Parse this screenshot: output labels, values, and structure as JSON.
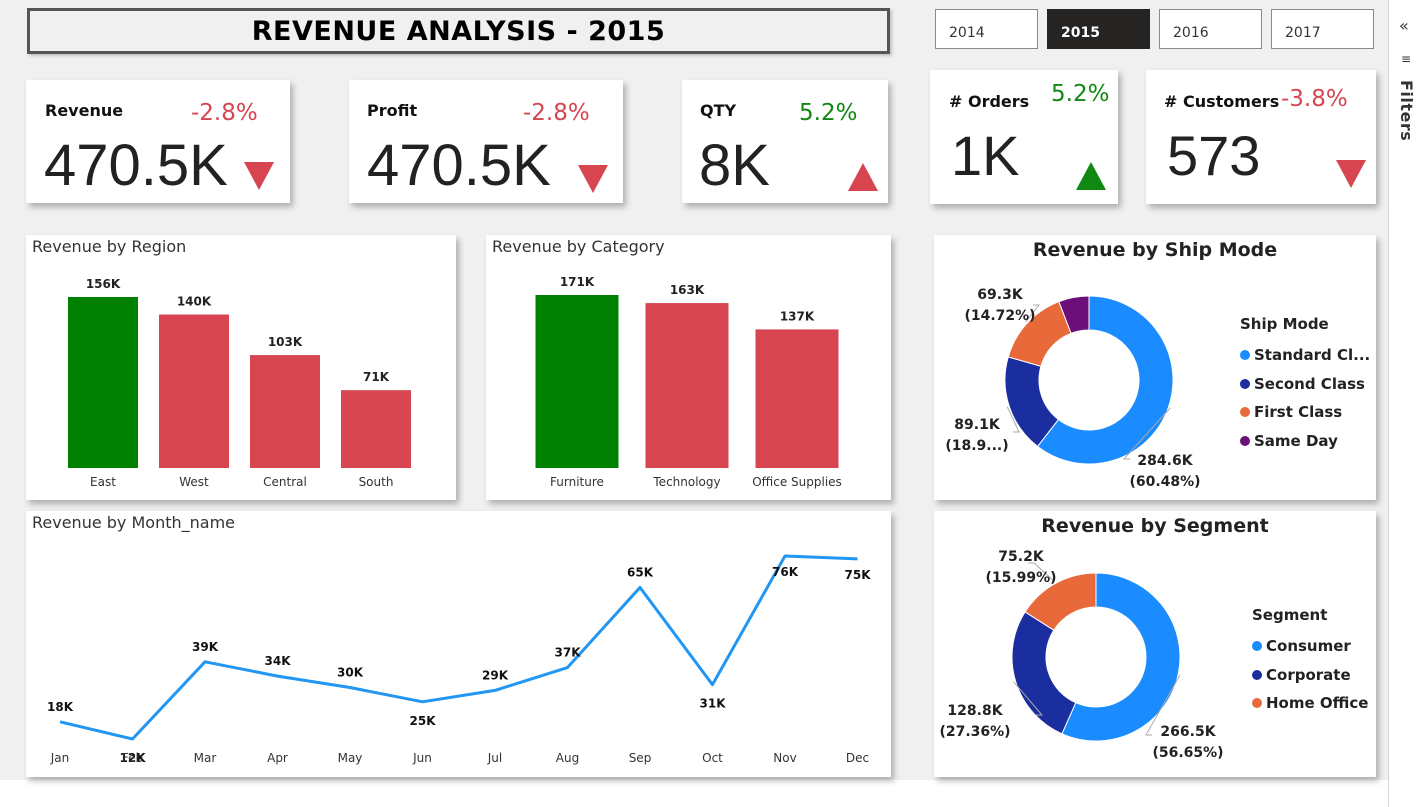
{
  "title": "REVENUE ANALYSIS - 2015",
  "years": [
    {
      "label": "2014",
      "active": false
    },
    {
      "label": "2015",
      "active": true
    },
    {
      "label": "2016",
      "active": false
    },
    {
      "label": "2017",
      "active": false
    }
  ],
  "kpis": [
    {
      "label": "Revenue",
      "value": "470.5K",
      "change": "-2.8%",
      "trend": "down"
    },
    {
      "label": "Profit",
      "value": "470.5K",
      "change": "-2.8%",
      "trend": "down"
    },
    {
      "label": "QTY",
      "value": "8K",
      "change": "5.2%",
      "trend": "up"
    },
    {
      "label": "# Orders",
      "value": "1K",
      "change": "5.2%",
      "trend": "up"
    },
    {
      "label": "# Customers",
      "value": "573",
      "change": "-3.8%",
      "trend": "down"
    }
  ],
  "colors": {
    "positive": "#118811",
    "negative": "#d64550",
    "bar_high": "#008000",
    "bar_other": "#d64550",
    "line": "#2196f3",
    "donut": [
      "#1a8cff",
      "#1a2ea0",
      "#e86a3a",
      "#6b0f7a"
    ]
  },
  "filters": {
    "label": "Filters"
  },
  "chart_data": [
    {
      "id": "region",
      "type": "bar",
      "title": "Revenue by Region",
      "categories": [
        "East",
        "West",
        "Central",
        "South"
      ],
      "values": [
        156,
        140,
        103,
        71
      ],
      "labels": [
        "156K",
        "140K",
        "103K",
        "71K"
      ],
      "highlight": [
        true,
        false,
        false,
        false
      ],
      "ylim": [
        0,
        156
      ]
    },
    {
      "id": "category",
      "type": "bar",
      "title": "Revenue by Category",
      "categories": [
        "Furniture",
        "Technology",
        "Office Supplies"
      ],
      "values": [
        171,
        163,
        137
      ],
      "labels": [
        "171K",
        "163K",
        "137K"
      ],
      "highlight": [
        true,
        false,
        false
      ],
      "ylim": [
        0,
        171
      ]
    },
    {
      "id": "month",
      "type": "line",
      "title": "Revenue by Month_name",
      "categories": [
        "Jan",
        "Feb",
        "Mar",
        "Apr",
        "May",
        "Jun",
        "Jul",
        "Aug",
        "Sep",
        "Oct",
        "Nov",
        "Dec"
      ],
      "values": [
        18,
        12,
        39,
        34,
        30,
        25,
        29,
        37,
        65,
        31,
        76,
        75
      ],
      "labels": [
        "18K",
        "12K",
        "39K",
        "34K",
        "30K",
        "25K",
        "29K",
        "37K",
        "65K",
        "31K",
        "76K",
        "75K"
      ],
      "ylim": [
        12,
        76
      ]
    },
    {
      "id": "shipmode",
      "type": "pie",
      "title": "Revenue by Ship Mode",
      "legend_title": "Ship Mode",
      "categories": [
        "Standard Cl...",
        "Second Class",
        "First Class",
        "Same Day"
      ],
      "values": [
        284.6,
        89.1,
        69.3,
        27.5
      ],
      "percents": [
        60.48,
        18.9,
        14.72,
        5.9
      ],
      "labels": [
        [
          "284.6K",
          "(60.48%)"
        ],
        [
          "89.1K",
          "(18.9...)"
        ],
        [
          "69.3K",
          "(14.72%)"
        ],
        [
          "",
          ""
        ]
      ]
    },
    {
      "id": "segment",
      "type": "pie",
      "title": "Revenue by Segment",
      "legend_title": "Segment",
      "categories": [
        "Consumer",
        "Corporate",
        "Home Office"
      ],
      "values": [
        266.5,
        128.8,
        75.2
      ],
      "percents": [
        56.65,
        27.36,
        15.99
      ],
      "labels": [
        [
          "266.5K",
          "(56.65%)"
        ],
        [
          "128.8K",
          "(27.36%)"
        ],
        [
          "75.2K",
          "(15.99%)"
        ]
      ]
    }
  ]
}
